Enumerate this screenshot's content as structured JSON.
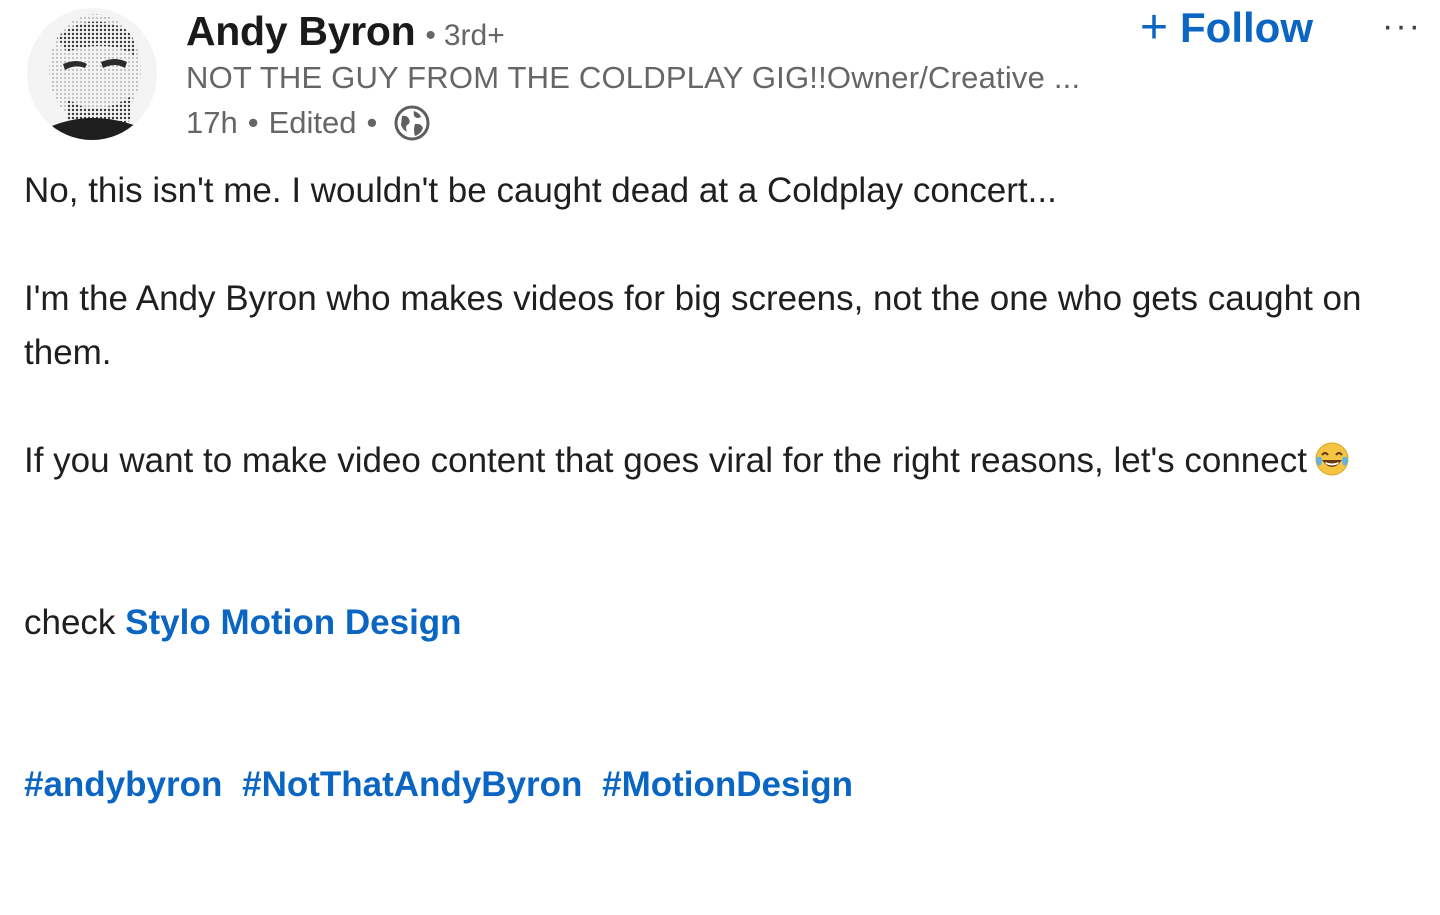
{
  "author": {
    "name": "Andy Byron",
    "degree_separator": "•",
    "degree": "3rd+",
    "headline": "NOT THE GUY FROM THE COLDPLAY GIG!!Owner/Creative ...",
    "time": "17h",
    "meta_separator": "•",
    "edited": "Edited",
    "avatar_icon": "avatar-photo",
    "visibility_icon": "globe-icon"
  },
  "actions": {
    "follow_plus": "+",
    "follow_label": "Follow",
    "more_label": "···"
  },
  "post": {
    "paragraph_1": "No, this isn't me. I wouldn't be caught dead at a Coldplay concert...",
    "paragraph_2": "I'm the Andy Byron who makes videos for big screens, not the one who gets caught on them.",
    "paragraph_3": "If you want to make video content that goes viral for the right reasons, let's connect",
    "paragraph_3_emoji": "tears-of-joy-emoji",
    "paragraph_4_prefix": "check",
    "paragraph_4_link": "Stylo Motion Design",
    "hashtags": [
      "#andybyron",
      "#NotThatAndyByron",
      "#MotionDesign"
    ]
  },
  "colors": {
    "link": "#0a66c2",
    "body_text": "#1f1f1f",
    "secondary_text": "#666666"
  }
}
